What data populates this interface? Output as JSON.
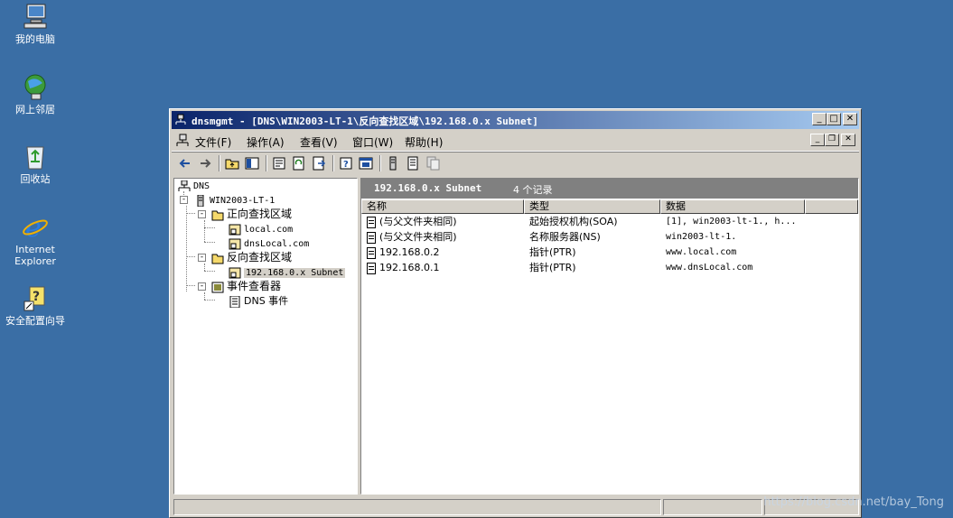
{
  "desktop": {
    "icons": [
      {
        "label": "我的电脑",
        "icon": "my-computer-icon"
      },
      {
        "label": "网上邻居",
        "icon": "network-neighborhood-icon"
      },
      {
        "label": "回收站",
        "icon": "recycle-bin-icon"
      },
      {
        "label_line1": "Internet",
        "label_line2": "Explorer",
        "icon": "internet-explorer-icon"
      },
      {
        "label": "安全配置向导",
        "icon": "security-wizard-icon"
      }
    ],
    "background": "#3a6ea5"
  },
  "window": {
    "title": "dnsmgmt - [DNS\\WIN2003-LT-1\\反向查找区域\\192.168.0.x Subnet]",
    "menu": [
      "文件(F)",
      "操作(A)",
      "查看(V)",
      "窗口(W)",
      "帮助(H)"
    ]
  },
  "tree": {
    "root": "DNS",
    "server": "WIN2003-LT-1",
    "forward_zone": "正向查找区域",
    "forward_items": [
      "local.com",
      "dnsLocal.com"
    ],
    "reverse_zone": "反向查找区域",
    "reverse_items": [
      "192.168.0.x Subnet"
    ],
    "event_viewer": "事件查看器",
    "event_items": [
      "DNS 事件"
    ]
  },
  "list": {
    "header_title": "192.168.0.x Subnet",
    "header_count": "4 个记录",
    "columns": [
      "名称",
      "类型",
      "数据"
    ],
    "rows": [
      {
        "name": "(与父文件夹相同)",
        "type": "起始授权机构(SOA)",
        "data": "[1], win2003-lt-1., h..."
      },
      {
        "name": "(与父文件夹相同)",
        "type": "名称服务器(NS)",
        "data": "win2003-lt-1."
      },
      {
        "name": "192.168.0.2",
        "type": "指针(PTR)",
        "data": "www.local.com"
      },
      {
        "name": "192.168.0.1",
        "type": "指针(PTR)",
        "data": "www.dnsLocal.com"
      }
    ]
  },
  "watermark": "https://blog.csdn.net/bay_Tong",
  "colors": {
    "title_start": "#0a246a",
    "title_end": "#a6caf0",
    "window_face": "#d4d0c8"
  }
}
